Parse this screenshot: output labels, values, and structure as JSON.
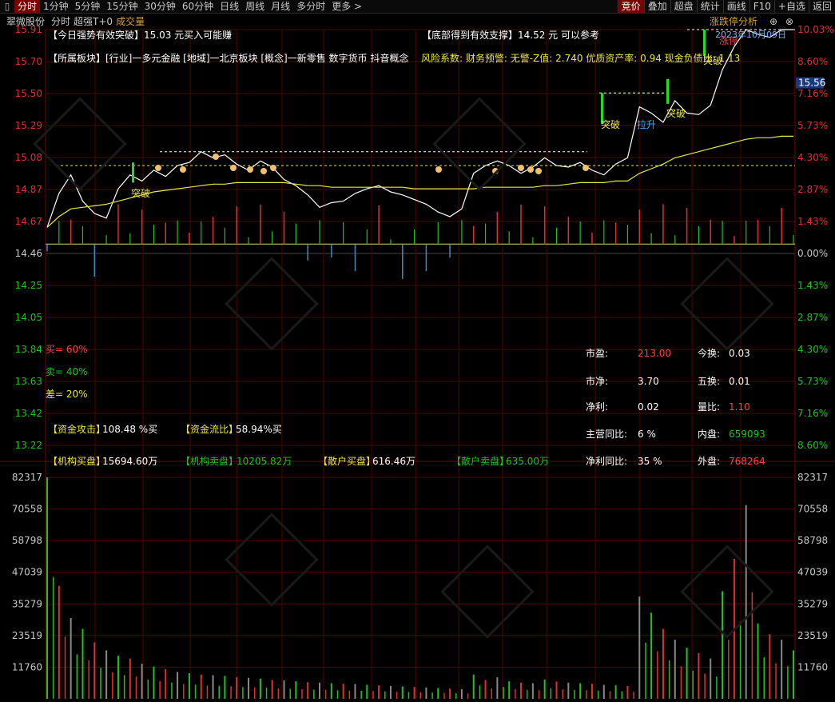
{
  "topbar": {
    "tabs": [
      "分时",
      "1分钟",
      "5分钟",
      "15分钟",
      "30分钟",
      "60分钟",
      "日线",
      "周线",
      "月线",
      "多分时",
      "更多 >"
    ],
    "active_tab": "分时",
    "right_tabs": [
      "竞价",
      "叠加",
      "超盘",
      "统计",
      "画线",
      "F10",
      "+自选",
      "返回"
    ],
    "right_active": "竞价"
  },
  "subbar": {
    "stock_name": "翠微股份",
    "mode": "分时",
    "overlay": "超强T+0",
    "volume_label": "成交量",
    "panel_title": "涨跌停分析"
  },
  "price_axis": {
    "left": [
      "15.91",
      "15.70",
      "15.50",
      "15.29",
      "15.08",
      "14.87",
      "14.67",
      "14.46",
      "14.25",
      "14.05",
      "13.84",
      "13.63",
      "13.42",
      "13.22"
    ],
    "right": [
      "10.03%",
      "8.60%",
      "7.16%",
      "5.73%",
      "4.30%",
      "2.87%",
      "1.43%",
      "0.00%",
      "1.43%",
      "2.87%",
      "4.30%",
      "5.73%",
      "7.16%",
      "8.60%"
    ],
    "current_price": "15.56"
  },
  "volume_axis": {
    "labels": [
      "82317",
      "70558",
      "58798",
      "47039",
      "35279",
      "23519",
      "11760"
    ]
  },
  "annotations": {
    "top_left_1": "【今日强势有效突破】15.03 元买入可能赚",
    "top_right_1": "【底部得到有效支撑】14.52 元 可以参考",
    "sector": "【所属板块】[行业]一多元金融 [地域]一北京板块 [概念]一新零售 数字货币 抖音概念",
    "risk": "风险系数: 财务预警: 无警-Z值: 2.740 优质资产率: 0.94 现金负债比: 1.13",
    "breakout": "突破",
    "pull": "拉升",
    "limit_up": "涨停",
    "date_mark": "2023年10月09日"
  },
  "ratios": {
    "buy": "买= 60%",
    "sell": "卖= 40%",
    "diff": "差= 20%"
  },
  "fund_flow": {
    "attack_label": "【资金攻击】",
    "attack_value": "108.48 %买",
    "flow_label": "【资金流比】",
    "flow_value": "58.94%买",
    "inst_buy_label": "【机构买盘】",
    "inst_buy_value": "15694.60万",
    "inst_sell_label": "【机构卖盘】",
    "inst_sell_value": "10205.82万",
    "retail_buy_label": "【散户买盘】",
    "retail_buy_value": "616.46万",
    "retail_sell_label": "【散户卖盘】",
    "retail_sell_value": "635.00万"
  },
  "stats": {
    "pe_label": "市盈:",
    "pe": "213.00",
    "turnover_label": "今换:",
    "turnover": "0.03",
    "pb_label": "市净:",
    "pb": "3.70",
    "turnover5_label": "五换:",
    "turnover5": "0.01",
    "profit_label": "净利:",
    "profit": "0.02",
    "volratio_label": "量比:",
    "volratio": "1.10",
    "rev_yoy_label": "主营同比:",
    "rev_yoy": "6 %",
    "inner_label": "内盘:",
    "inner": "659093",
    "profit_yoy_label": "净利同比:",
    "profit_yoy": "35 %",
    "outer_label": "外盘:",
    "outer": "768264"
  },
  "chart_data": {
    "type": "line",
    "title": "",
    "series": [
      {
        "values": [
          14.63,
          14.85,
          14.97,
          14.8,
          14.72,
          14.69,
          14.88,
          14.97,
          14.93,
          15.0,
          14.96,
          15.03,
          15.05,
          15.12,
          15.08,
          15.1,
          15.04,
          15.0,
          15.06,
          15.02,
          14.94,
          14.9,
          14.84,
          14.76,
          14.79,
          14.8,
          14.85,
          14.88,
          14.9,
          14.86,
          14.84,
          14.81,
          14.78,
          14.73,
          14.7,
          14.75,
          14.98,
          15.03,
          15.06,
          15.03,
          14.98,
          15.02,
          15.08,
          15.03,
          15.02,
          15.05,
          15.0,
          14.97,
          15.04,
          15.08,
          15.41,
          15.37,
          15.31,
          15.45,
          15.37,
          15.36,
          15.42,
          15.65,
          15.8,
          15.91,
          15.88,
          15.86,
          15.91,
          15.91
        ]
      },
      {
        "values": [
          14.63,
          14.7,
          14.75,
          14.76,
          14.77,
          14.78,
          14.8,
          14.82,
          14.84,
          14.86,
          14.87,
          14.88,
          14.89,
          14.9,
          14.91,
          14.91,
          14.92,
          14.92,
          14.92,
          14.92,
          14.92,
          14.91,
          14.9,
          14.9,
          14.89,
          14.89,
          14.89,
          14.89,
          14.89,
          14.89,
          14.89,
          14.88,
          14.88,
          14.88,
          14.88,
          14.88,
          14.88,
          14.89,
          14.89,
          14.89,
          14.89,
          14.89,
          14.9,
          14.9,
          14.91,
          14.92,
          14.92,
          14.92,
          14.93,
          14.93,
          14.98,
          15.01,
          15.04,
          15.08,
          15.1,
          15.12,
          15.14,
          15.16,
          15.18,
          15.2,
          15.21,
          15.21,
          15.22,
          15.22
        ]
      }
    ],
    "ylim": [
      13.22,
      15.91
    ],
    "volume": [
      82317,
      42000,
      30000,
      26000,
      21000,
      18000,
      16000,
      15000,
      13000,
      12000,
      11000,
      10000,
      9500,
      9000,
      8800,
      8500,
      8000,
      7800,
      7500,
      7000,
      6800,
      6500,
      6200,
      6000,
      5800,
      5600,
      5500,
      5200,
      5000,
      4800,
      4600,
      4400,
      4200,
      4000,
      3800,
      3600,
      9000,
      7000,
      8000,
      6500,
      6000,
      5800,
      7200,
      6400,
      6000,
      5800,
      5600,
      5200,
      5000,
      4800,
      38000,
      32000,
      26000,
      22000,
      19000,
      17000,
      15000,
      40000,
      52000,
      72000,
      28000,
      24000,
      22000,
      18000
    ],
    "volume_ylim": [
      0,
      82317
    ],
    "grid": true
  }
}
